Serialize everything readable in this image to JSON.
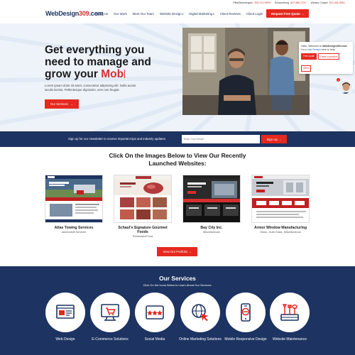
{
  "topbar": {
    "phones": [
      {
        "city": "Pitts/Bloomington",
        "number": "309-212-9999"
      },
      {
        "city": "Schaumburg",
        "number": "847-986-2237"
      },
      {
        "city": "Wesley Chapel",
        "number": "813-481-5651"
      }
    ]
  },
  "header": {
    "logo": {
      "web": "WebDesign",
      "num": "309",
      "com": ".com"
    },
    "nav": [
      "About Us",
      "Our Work",
      "Meet Our Team",
      "Website Design",
      "Digital Marketing",
      "Client Reviews",
      "Client Login"
    ],
    "quote_button": "Request Free Quote"
  },
  "hero": {
    "headline_line1": "Get everything you",
    "headline_line2": "need to manage and",
    "headline_line3_prefix": "grow your ",
    "headline_typed": "Mob",
    "lede": "Lorem ipsum dolor sit amet, consectetur adipiscing elit. Nulla auctor iaculis lacinia. Pellentesque dignissim, sem non feugiat.",
    "services_button": "Our Services"
  },
  "chat": {
    "message_start": "Hello, Welcome to ",
    "message_site": "WebDesign309.com",
    "message_mid": "! I'm a ",
    "message_live": "Live Person",
    "message_end": " here to help.",
    "btn_quote": "Free Quote",
    "btn_question": "I have a question",
    "btn_other": "Other",
    "badge": "1"
  },
  "newsletter": {
    "label": "Sign up for our newsletter to receive important tips and industry updates",
    "placeholder": "Enter Your Email*",
    "button": "Sign Up"
  },
  "portfolio": {
    "title_line1": "Click On the Images Below to View Our Recently",
    "title_line2": "Launched Websites:",
    "items": [
      {
        "name": "Atlas Towing Services",
        "category": "Automobile Services"
      },
      {
        "name": "Schaul's Signature Gourmet Foods",
        "category": "Restaurant/Food"
      },
      {
        "name": "Bay City Inc.",
        "category": "Miscellaneous"
      },
      {
        "name": "Armor Window Manufacturing",
        "category": "Glass - Auto Glass, Miscellaneous"
      }
    ],
    "button": "View Our Portfolio"
  },
  "services": {
    "title": "Our Services",
    "subtitle": "Click On the Icons Below to Learn About Our Services:",
    "items": [
      {
        "label": "Web Design",
        "icon": "web-design-icon"
      },
      {
        "label": "E-Commerce Solutions",
        "icon": "ecommerce-icon"
      },
      {
        "label": "Social Media",
        "icon": "social-media-icon"
      },
      {
        "label": "Online Marketing Solutions",
        "icon": "online-marketing-icon"
      },
      {
        "label": "Mobile Responsive Design",
        "icon": "mobile-design-icon"
      },
      {
        "label": "Website Maintenance",
        "icon": "maintenance-icon"
      }
    ]
  },
  "colors": {
    "navy": "#1d3361",
    "red": "#e5291f",
    "hero_bg": "#eef3fa"
  }
}
